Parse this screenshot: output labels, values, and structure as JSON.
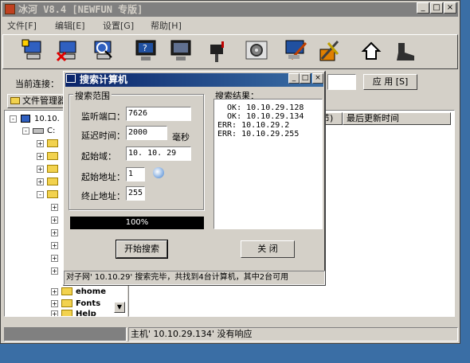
{
  "main_window": {
    "title": "冰河 V8.4 [NEWFUN 专版]",
    "title_buttons": [
      "_",
      "□",
      "×"
    ],
    "menu": [
      "文件[F]",
      "编辑[E]",
      "设置[G]",
      "帮助[H]"
    ],
    "toolbar_icons": [
      "computer-add-icon",
      "computer-remove-icon",
      "computer-search-icon",
      "monitor-help-icon",
      "monitor-capture-icon",
      "mailbox-icon",
      "settings-gear-icon",
      "draw-edit-icon",
      "tools-icon",
      "home-icon",
      "boot-icon"
    ],
    "connection_label": "当前连接：",
    "apply_label": "应 用 [S]",
    "file_manager_tab": "文件管理器",
    "list_headers": [
      "节)",
      "最后更新时间"
    ],
    "tree": {
      "root": "10.10.",
      "drive": "C:",
      "items": [
        "ehome",
        "Fonts",
        "Help"
      ]
    },
    "status_text": "主机' 10.10.29.134' 没有响应"
  },
  "dialog": {
    "title": "搜索计算机",
    "title_buttons": [
      "_",
      "□",
      "×"
    ],
    "search_range_label": "搜索范围",
    "fields": {
      "listen_port_label": "监听端口：",
      "listen_port": "7626",
      "delay_label": "延迟时间：",
      "delay": "2000",
      "delay_unit": "毫秒",
      "start_domain_label": "起始域：",
      "start_domain": "10. 10. 29",
      "start_addr_label": "起始地址：",
      "start_addr": "1",
      "end_addr_label": "终止地址：",
      "end_addr": "255"
    },
    "result_label": "搜索结果：",
    "results": [
      "  OK: 10.10.29.128",
      "  OK: 10.10.29.134",
      "ERR: 10.10.29.2",
      "ERR: 10.10.29.255"
    ],
    "progress_text": "100%",
    "progress_value": 1.0,
    "start_button": "开始搜索",
    "close_button": "关 闭",
    "status_text": "对子网' 10.10.29' 搜索完毕，共找到4台计算机，其中2台可用"
  }
}
